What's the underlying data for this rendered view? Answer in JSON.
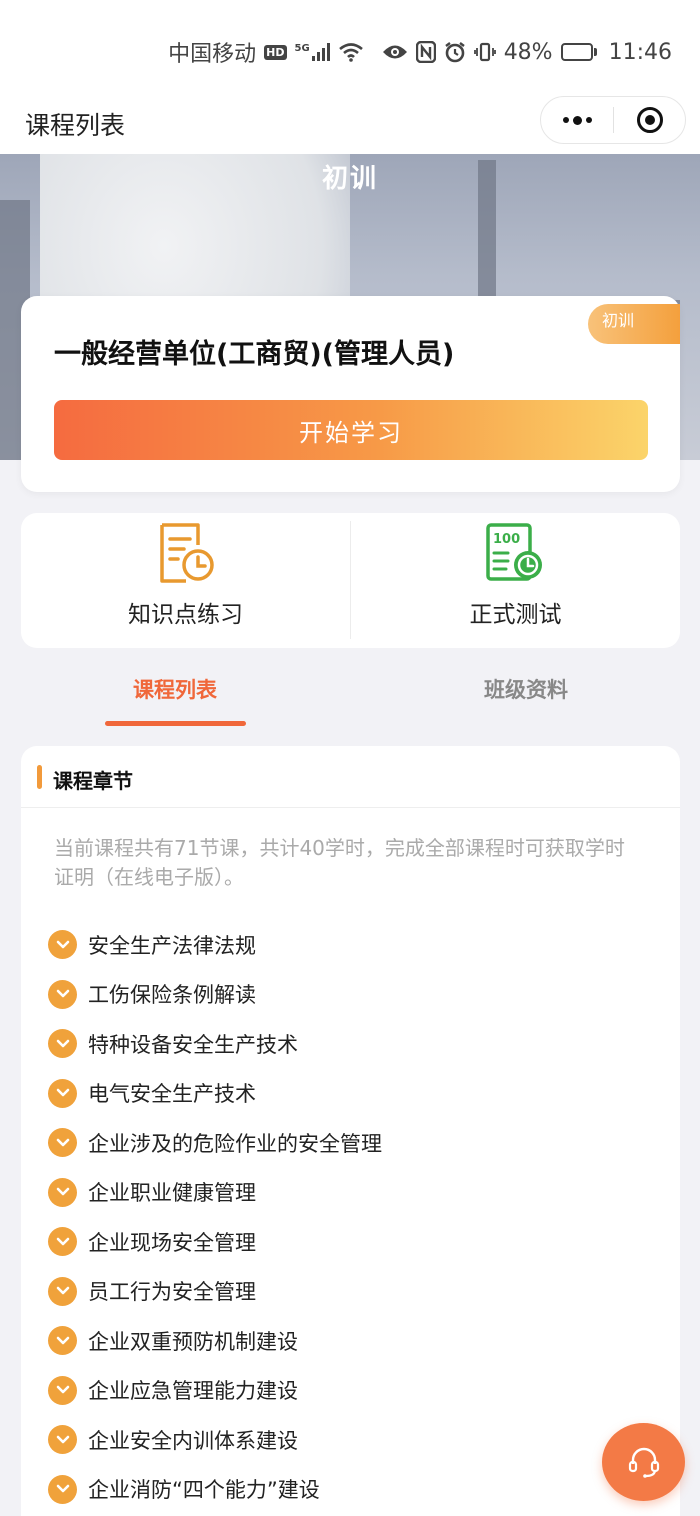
{
  "status_bar": {
    "carrier": "中国移动",
    "hd": "HD",
    "network": "5G",
    "battery_percent_text": "48%",
    "battery_level": 0.48,
    "time": "11:46"
  },
  "nav": {
    "title": "课程列表",
    "more_icon": "more-dots-icon",
    "close_icon": "target-close-icon"
  },
  "banner": {
    "title": "初训"
  },
  "course": {
    "badge": "初训",
    "title": "一般经营单位(工商贸)(管理人员)",
    "start_label": "开始学习"
  },
  "actions": [
    {
      "label": "知识点练习",
      "icon": "exercise-clock-icon",
      "color": "#e8992f"
    },
    {
      "label": "正式测试",
      "icon": "exam-100-icon",
      "color": "#3bae49"
    }
  ],
  "tabs": [
    {
      "label": "课程列表",
      "active": true
    },
    {
      "label": "班级资料",
      "active": false
    }
  ],
  "chapters": {
    "header": "课程章节",
    "description": "当前课程共有71节课，共计40学时，完成全部课程时可获取学时证明（在线电子版）。",
    "items": [
      "安全生产法律法规",
      "工伤保险条例解读",
      "特种设备安全生产技术",
      "电气安全生产技术",
      "企业涉及的危险作业的安全管理",
      "企业职业健康管理",
      "企业现场安全管理",
      "员工行为安全管理",
      "企业双重预防机制建设",
      "企业应急管理能力建设",
      "企业安全内训体系建设",
      "企业消防“四个能力”建设"
    ]
  },
  "colors": {
    "accent": "#f0673a",
    "chevron": "#f0a23b",
    "exercise_icon": "#e8992f",
    "exam_icon": "#3bae49"
  }
}
